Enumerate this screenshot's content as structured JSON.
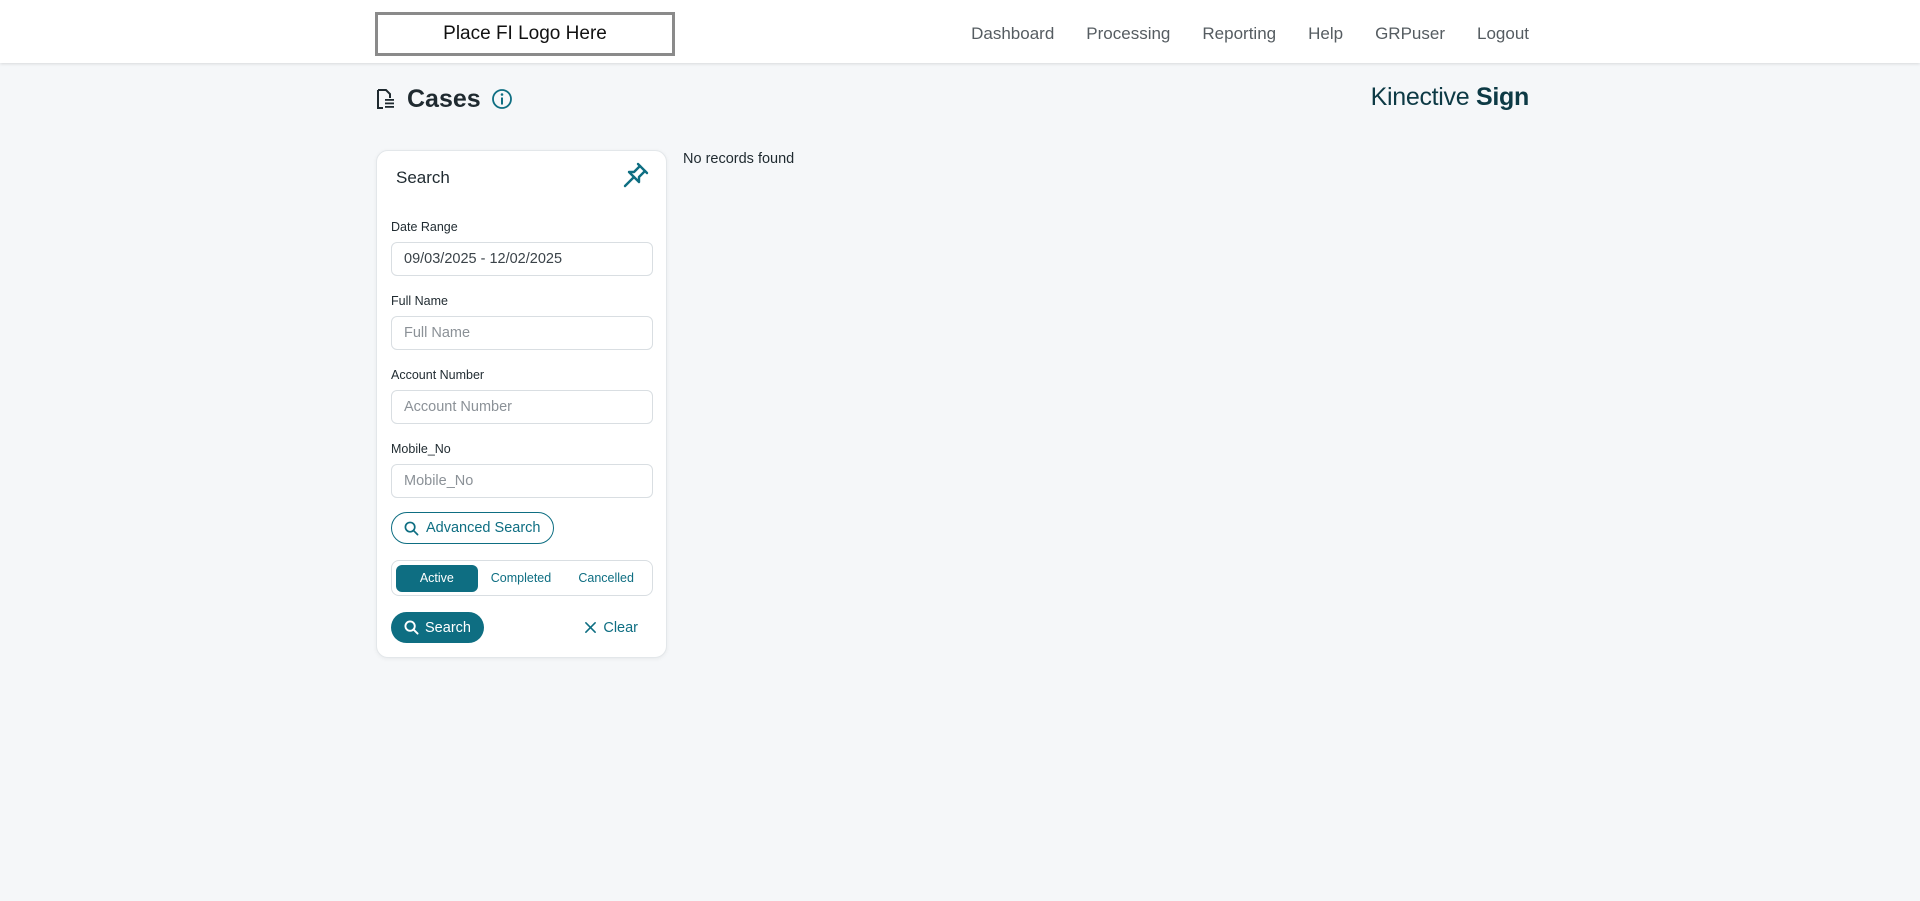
{
  "header": {
    "logo_text": "Place FI Logo Here",
    "nav": [
      "Dashboard",
      "Processing",
      "Reporting",
      "Help",
      "GRPuser",
      "Logout"
    ]
  },
  "page": {
    "title": "Cases",
    "brand_light": "Kinective",
    "brand_bold": "Sign"
  },
  "search_panel": {
    "title": "Search",
    "fields": [
      {
        "label": "Date Range",
        "value": "09/03/2025 - 12/02/2025",
        "placeholder": ""
      },
      {
        "label": "Full Name",
        "value": "",
        "placeholder": "Full Name"
      },
      {
        "label": "Account Number",
        "value": "",
        "placeholder": "Account Number"
      },
      {
        "label": "Mobile_No",
        "value": "",
        "placeholder": "Mobile_No"
      }
    ],
    "advanced_label": "Advanced Search",
    "status_tabs": [
      "Active",
      "Completed",
      "Cancelled"
    ],
    "active_tab": "Active",
    "search_label": "Search",
    "clear_label": "Clear"
  },
  "results": {
    "empty_message": "No records found"
  },
  "colors": {
    "accent": "#0e6e82",
    "background": "#f5f7f9",
    "brand_text": "#0d3a45"
  },
  "icons": [
    "document-icon",
    "info-icon",
    "pin-icon",
    "search-icon",
    "close-icon"
  ]
}
